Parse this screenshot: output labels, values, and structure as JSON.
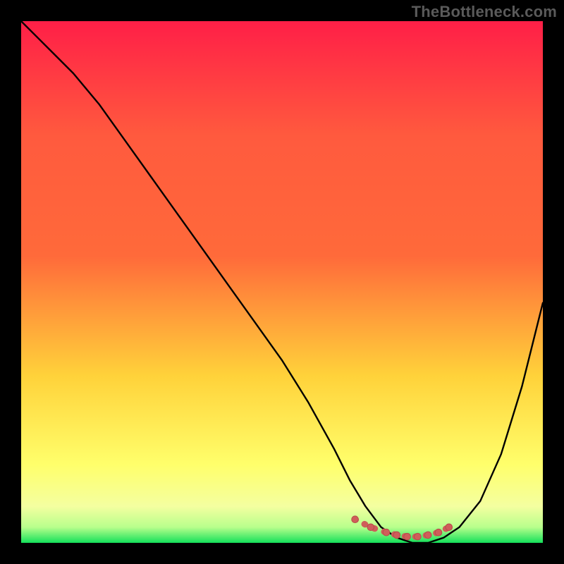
{
  "watermark": "TheBottleneck.com",
  "colors": {
    "frame": "#000000",
    "grad_top": "#ff1f47",
    "grad_upper_mid": "#ff6a3a",
    "grad_mid": "#ffd23a",
    "grad_lower_mid": "#ffff6b",
    "grad_low": "#f4ffa0",
    "grad_bottom": "#14e05a",
    "curve": "#000000",
    "marker_fill": "#cf5d5a",
    "marker_stroke": "#b64c49"
  },
  "chart_data": {
    "type": "line",
    "title": "",
    "xlabel": "",
    "ylabel": "",
    "xlim": [
      0,
      100
    ],
    "ylim": [
      0,
      100
    ],
    "series": [
      {
        "name": "bottleneck-curve",
        "x": [
          0,
          3,
          6,
          10,
          15,
          20,
          25,
          30,
          35,
          40,
          45,
          50,
          55,
          60,
          63,
          66,
          69,
          72,
          75,
          78,
          81,
          84,
          88,
          92,
          96,
          100
        ],
        "y": [
          100,
          97,
          94,
          90,
          84,
          77,
          70,
          63,
          56,
          49,
          42,
          35,
          27,
          18,
          12,
          7,
          3,
          1,
          0,
          0,
          1,
          3,
          8,
          17,
          30,
          46
        ]
      }
    ],
    "markers": {
      "name": "optimal-band",
      "x": [
        64,
        67,
        70,
        72,
        74,
        76,
        78,
        80,
        82
      ],
      "y": [
        4.5,
        3.0,
        2.0,
        1.5,
        1.2,
        1.2,
        1.5,
        2.0,
        3.0
      ]
    }
  }
}
